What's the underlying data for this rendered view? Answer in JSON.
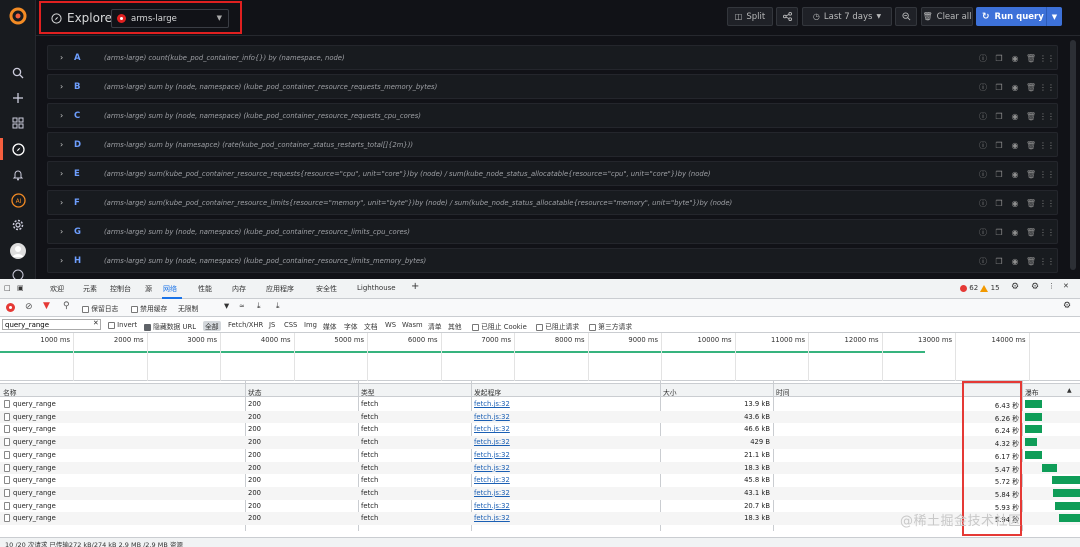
{
  "grafana": {
    "explore_title": "Explore",
    "datasource": "arms-large",
    "toolbar": {
      "split_label": "Split",
      "time_range_label": "Last 7 days",
      "clear_all_label": "Clear all",
      "run_query_label": "Run query"
    },
    "queries": [
      {
        "ref": "A",
        "expr": "(arms-large)   count(kube_pod_container_info{}) by (namespace, node)"
      },
      {
        "ref": "B",
        "expr": "(arms-large)   sum by (node, namespace) (kube_pod_container_resource_requests_memory_bytes)"
      },
      {
        "ref": "C",
        "expr": "(arms-large)   sum by (node, namespace) (kube_pod_container_resource_requests_cpu_cores)"
      },
      {
        "ref": "D",
        "expr": "(arms-large)   sum by (namesapce) (rate(kube_pod_container_status_restarts_total[]{2m}))"
      },
      {
        "ref": "E",
        "expr": "(arms-large)   sum(kube_pod_container_resource_requests{resource=\"cpu\", unit=\"core\"})by (node) / sum(kube_node_status_allocatable{resource=\"cpu\", unit=\"core\"})by (node)"
      },
      {
        "ref": "F",
        "expr": "(arms-large)   sum(kube_pod_container_resource_limits{resource=\"memory\", unit=\"byte\"})by (node) / sum(kube_node_status_allocatable{resource=\"memory\", unit=\"byte\"})by (node)"
      },
      {
        "ref": "G",
        "expr": "(arms-large)   sum by (node, namespace) (kube_pod_container_resource_limits_cpu_cores)"
      },
      {
        "ref": "H",
        "expr": "(arms-large)   sum by (node, namespace) (kube_pod_container_resource_limits_memory_bytes)"
      }
    ]
  },
  "devtools": {
    "tabs": [
      "欢迎",
      "元素",
      "控制台",
      "源",
      "网络",
      "性能",
      "内存",
      "应用程序",
      "安全性",
      "Lighthouse"
    ],
    "error_count": "62",
    "warning_count": "15",
    "toolbar": {
      "preserve_log": "保留日志",
      "disable_cache": "禁用缓存",
      "throttling": "无限制"
    },
    "filter": {
      "value": "query_range",
      "invert": "Invert",
      "hide_data_urls": "隐藏数据 URL",
      "types": [
        "全部",
        "Fetch/XHR",
        "JS",
        "CSS",
        "Img",
        "媒体",
        "字体",
        "文档",
        "WS",
        "Wasm",
        "清单",
        "其他"
      ],
      "blocked_cookies": "已阻止 Cookie",
      "blocked_requests": "已阻止请求",
      "third_party": "第三方请求"
    },
    "timeline_ticks": [
      "1000 ms",
      "2000 ms",
      "3000 ms",
      "4000 ms",
      "5000 ms",
      "6000 ms",
      "7000 ms",
      "8000 ms",
      "9000 ms",
      "10000 ms",
      "11000 ms",
      "12000 ms",
      "13000 ms",
      "14000 ms",
      "150"
    ],
    "columns": [
      "名称",
      "状态",
      "类型",
      "发起程序",
      "大小",
      "时间",
      "瀑布"
    ],
    "rows": [
      {
        "name": "query_range",
        "status": "200",
        "type": "fetch",
        "initiator": "fetch.js:32",
        "size": "13.9 kB",
        "time": "6.43 秒",
        "wf_start": 0.02,
        "wf_width": 0.31
      },
      {
        "name": "query_range",
        "status": "200",
        "type": "fetch",
        "initiator": "fetch.js:32",
        "size": "43.6 kB",
        "time": "6.26 秒",
        "wf_start": 0.02,
        "wf_width": 0.3
      },
      {
        "name": "query_range",
        "status": "200",
        "type": "fetch",
        "initiator": "fetch.js:32",
        "size": "46.6 kB",
        "time": "6.24 秒",
        "wf_start": 0.02,
        "wf_width": 0.3
      },
      {
        "name": "query_range",
        "status": "200",
        "type": "fetch",
        "initiator": "fetch.js:32",
        "size": "429 B",
        "time": "4.32 秒",
        "wf_start": 0.02,
        "wf_width": 0.21
      },
      {
        "name": "query_range",
        "status": "200",
        "type": "fetch",
        "initiator": "fetch.js:32",
        "size": "21.1 kB",
        "time": "6.17 秒",
        "wf_start": 0.02,
        "wf_width": 0.3
      },
      {
        "name": "query_range",
        "status": "200",
        "type": "fetch",
        "initiator": "fetch.js:32",
        "size": "18.3 kB",
        "time": "5.47 秒",
        "wf_start": 0.33,
        "wf_width": 0.26
      },
      {
        "name": "query_range",
        "status": "200",
        "type": "fetch",
        "initiator": "fetch.js:32",
        "size": "45.8 kB",
        "time": "5.72 秒",
        "wf_start": 0.5,
        "wf_width": 0.5
      },
      {
        "name": "query_range",
        "status": "200",
        "type": "fetch",
        "initiator": "fetch.js:32",
        "size": "43.1 kB",
        "time": "5.84 秒",
        "wf_start": 0.52,
        "wf_width": 0.48
      },
      {
        "name": "query_range",
        "status": "200",
        "type": "fetch",
        "initiator": "fetch.js:32",
        "size": "20.7 kB",
        "time": "5.93 秒",
        "wf_start": 0.56,
        "wf_width": 0.44
      },
      {
        "name": "query_range",
        "status": "200",
        "type": "fetch",
        "initiator": "fetch.js:32",
        "size": "18.3 kB",
        "time": "5.94 秒",
        "wf_start": 0.62,
        "wf_width": 0.38
      }
    ],
    "status_bar": "10 /20 次请求  已传输272 kB/274 kB  2.9 MB /2.9 MB 资源"
  },
  "watermark": "@稀土掘金技术社区",
  "colors": {
    "accent": "#3d71d9",
    "highlight": "#e53935",
    "success": "#0f9d58",
    "grafana_bg": "#111217"
  }
}
